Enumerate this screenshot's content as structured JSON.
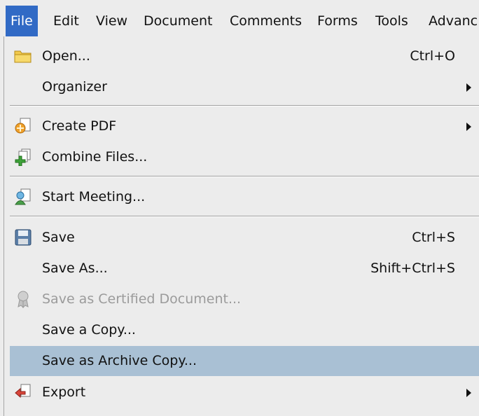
{
  "menubar": {
    "items": [
      {
        "label": "File",
        "active": true
      },
      {
        "label": "Edit"
      },
      {
        "label": "View"
      },
      {
        "label": "Document"
      },
      {
        "label": "Comments"
      },
      {
        "label": "Forms"
      },
      {
        "label": "Tools"
      },
      {
        "label": "Advanc"
      }
    ]
  },
  "file_menu": {
    "items": [
      {
        "label": "Open...",
        "shortcut": "Ctrl+O",
        "icon": "folder-icon"
      },
      {
        "label": "Organizer",
        "submenu": true
      },
      {
        "label": "Create PDF",
        "submenu": true,
        "icon": "create-pdf-icon"
      },
      {
        "label": "Combine Files...",
        "icon": "combine-files-icon"
      },
      {
        "label": "Start Meeting...",
        "icon": "meeting-icon"
      },
      {
        "label": "Save",
        "shortcut": "Ctrl+S",
        "icon": "floppy-disk-icon"
      },
      {
        "label": "Save As...",
        "shortcut": "Shift+Ctrl+S"
      },
      {
        "label": "Save as Certified Document...",
        "disabled": true,
        "icon": "certificate-ribbon-icon"
      },
      {
        "label": "Save a Copy..."
      },
      {
        "label": "Save as Archive Copy...",
        "highlighted": true
      },
      {
        "label": "Export",
        "submenu": true,
        "icon": "export-icon"
      }
    ]
  },
  "colors": {
    "menu_background": "#ececec",
    "active_menubar_item": "#316ac5",
    "hover_item": "#a9c0d4",
    "disabled_text": "#9b9b9b"
  }
}
